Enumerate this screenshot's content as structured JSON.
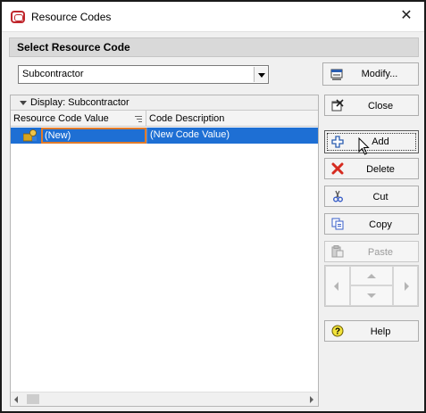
{
  "window": {
    "title": "Resource Codes",
    "close_glyph": "✕"
  },
  "section": {
    "title": "Select Resource Code"
  },
  "combo": {
    "value": "Subcontractor"
  },
  "buttons": {
    "modify": "Modify...",
    "close": "Close",
    "add": "Add",
    "delete": "Delete",
    "cut": "Cut",
    "copy": "Copy",
    "paste": "Paste",
    "help": "Help"
  },
  "grid": {
    "display_label": "Display: Subcontractor",
    "columns": [
      "Resource Code Value",
      "Code Description"
    ],
    "rows": [
      {
        "value": "(New)",
        "description": "(New Code Value)"
      }
    ]
  },
  "colors": {
    "selection": "#1e6fd4",
    "edit_border": "#e07b2a",
    "delete_red": "#d62b20",
    "brand_red": "#c0272d"
  },
  "icons": {
    "app": "oracle-app-icon",
    "modify": "modify-icon",
    "close": "close-window-icon",
    "add": "plus-icon",
    "delete": "red-x-icon",
    "cut": "scissors-icon",
    "copy": "copy-icon",
    "paste": "paste-icon",
    "help": "question-icon",
    "row": "resource-code-icon"
  }
}
